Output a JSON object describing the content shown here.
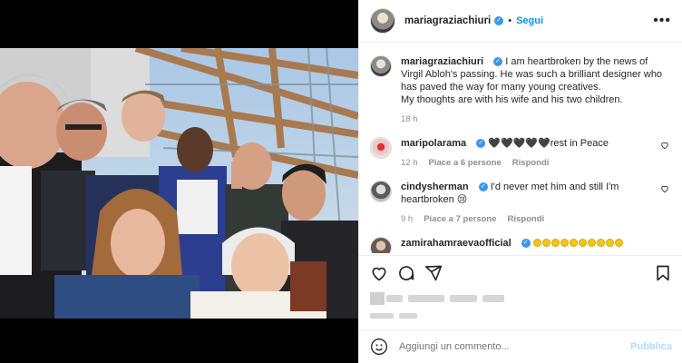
{
  "post": {
    "username": "mariagraziachiuri",
    "follow_label": "Segui",
    "more_label": "•••",
    "verified_mark": "✓",
    "dot": "•"
  },
  "caption": {
    "username": "mariagraziachiuri",
    "text": "I am heartbroken by the news of Virgil Abloh's passing. He was such a brilliant designer who has paved the way for many young creatives.",
    "text2": "My thoughts are with his wife and his two children.",
    "time": "18 h"
  },
  "comments": [
    {
      "username": "maripolarama",
      "text": "🖤🖤🖤🖤🖤rest in Peace",
      "time": "12 h",
      "likes": "Piace a 6 persone",
      "reply": "Rispondi"
    },
    {
      "username": "cindysherman",
      "text": "I'd never met him and still I'm heartbroken 😢",
      "time": "9 h",
      "likes": "Piace a 7 persone",
      "reply": "Rispondi"
    },
    {
      "username": "zamirahamraevaofficial",
      "text": ""
    }
  ],
  "composer": {
    "placeholder": "Aggiungi un commento...",
    "publish_label": "Pubblica"
  },
  "colors": {
    "accent": "#0095f6",
    "verified": "#3897f0",
    "publish_disabled": "#b3dbff"
  },
  "icons": [
    "heart-icon",
    "comment-icon",
    "share-icon",
    "bookmark-icon",
    "emoji-icon",
    "more-icon"
  ]
}
